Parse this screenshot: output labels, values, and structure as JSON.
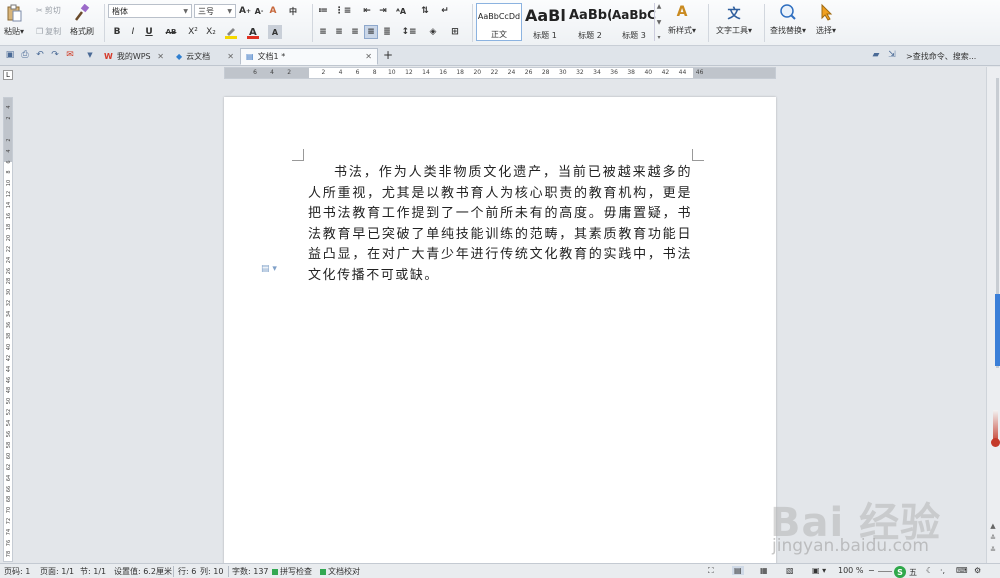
{
  "ribbon": {
    "clipboard": {
      "paste": "粘贴",
      "cut": "剪切",
      "copy": "复制",
      "format_painter": "格式刷"
    },
    "font": {
      "name": "楷体",
      "size": "三号"
    },
    "styles": [
      {
        "preview": "AaBbCcDd",
        "label": "正文"
      },
      {
        "preview": "AaBl",
        "label": "标题 1"
      },
      {
        "preview": "AaBb(",
        "label": "标题 2"
      },
      {
        "preview": "AaBbC",
        "label": "标题 3"
      }
    ],
    "new_style": "新样式",
    "text_tools": "文字工具",
    "find_replace": "查找替换",
    "select": "选择",
    "dropdown_arrow": "▾"
  },
  "tabbar": {
    "tabs": [
      {
        "label": "我的WPS"
      },
      {
        "label": "云文档"
      },
      {
        "label": "文档1 *"
      }
    ],
    "add": "+",
    "search": ">查找命令、搜索..."
  },
  "ruler": {
    "h_numbers": [
      "6",
      "4",
      "2",
      "",
      "2",
      "4",
      "6",
      "8",
      "10",
      "12",
      "14",
      "16",
      "18",
      "20",
      "22",
      "24",
      "26",
      "28",
      "30",
      "32",
      "34",
      "36",
      "38",
      "40",
      "42",
      "44",
      "46"
    ],
    "v_numbers": [
      "4",
      "2",
      "",
      "2",
      "4",
      "6",
      "8",
      "10",
      "12",
      "14",
      "16",
      "18",
      "20",
      "22",
      "24",
      "26",
      "28",
      "30",
      "32",
      "34",
      "36",
      "38",
      "40",
      "42",
      "44",
      "46",
      "48",
      "50",
      "52",
      "54",
      "56",
      "58",
      "60",
      "62",
      "64",
      "66",
      "68",
      "70",
      "72",
      "74",
      "76",
      "78",
      "80"
    ],
    "corner": "L"
  },
  "document": {
    "paragraph": "书法，作为人类非物质文化遗产，当前已被越来越多的人所重视，尤其是以教书育人为核心职责的教育机构，更是把书法教育工作提到了一个前所未有的高度。毋庸置疑，书法教育早已突破了单纯技能训练的范畴，其素质教育功能日益凸显，在对广大青少年进行传统文化教育的实践中，书法文化传播不可或缺。"
  },
  "status": {
    "page_code": "页码: 1",
    "pages": "页面: 1/1",
    "section": "节: 1/1",
    "setting": "设置值: 6.2厘米",
    "row": "行: 6",
    "col": "列: 10",
    "word_count": "字数: 137",
    "spell_check": "拼写检查",
    "doc_proof": "文档校对",
    "zoom": "100 %",
    "ime": "五"
  },
  "watermark": {
    "main": "Bai  经验",
    "sub": "jingyan.baidu.com"
  },
  "colors": {
    "accent": "#3b7fd8",
    "red": "#c43a2a",
    "ribbon_bg": "#eef1f4",
    "page": "#ffffff"
  }
}
